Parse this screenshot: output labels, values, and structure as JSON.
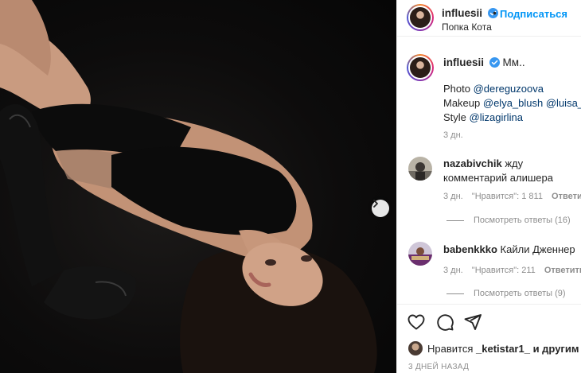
{
  "post": {
    "username": "influesii",
    "dot": "•",
    "follow_label": "Подписаться",
    "location": "Попка Кота"
  },
  "caption": {
    "username": "influesii",
    "text": "Мм..",
    "credits": [
      {
        "role": "Photo",
        "handles": [
          "@dereguzoova"
        ]
      },
      {
        "role": "Makeup",
        "handles": [
          "@elya_blush",
          "@luisa_kh"
        ]
      },
      {
        "role": "Style",
        "handles": [
          "@lizagirlina"
        ]
      }
    ],
    "time": "3 дн."
  },
  "comments": [
    {
      "username": "nazabivchik",
      "text": "жду комментарий алишера",
      "time": "3 дн.",
      "likes": "\"Нравится\": 1 811",
      "reply_label": "Ответить",
      "view_replies": "Посмотреть ответы (16)"
    },
    {
      "username": "babenkkko",
      "text": "Кайли Дженнер",
      "time": "3 дн.",
      "likes": "\"Нравится\": 211",
      "reply_label": "Ответить",
      "view_replies": "Посмотреть ответы (9)"
    }
  ],
  "likes": {
    "prefix": "Нравится",
    "user": "_ketistar1_",
    "suffix": "и другим"
  },
  "posted_ago": "3 ДНЕЙ НАЗАД",
  "icons": {
    "next": "chevron-right-icon",
    "like": "heart-icon",
    "comment": "comment-bubble-icon",
    "share": "paper-plane-icon",
    "verified": "verified-badge-icon"
  },
  "colors": {
    "link_blue": "#0095f6",
    "mention": "#00376b",
    "muted": "#8e8e8e",
    "verified": "#3897f0"
  }
}
